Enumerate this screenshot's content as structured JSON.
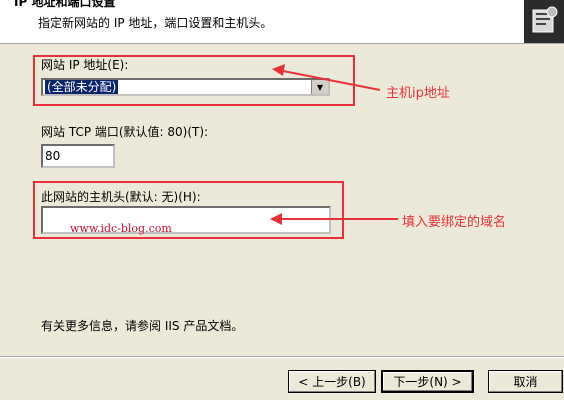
{
  "header": {
    "title": "IP 地址和端口设置",
    "subtitle": "指定新网站的 IP 地址，端口设置和主机头。"
  },
  "ip": {
    "label": "网站 IP 地址(E):",
    "selected": "(全部未分配)"
  },
  "port": {
    "label": "网站 TCP 端口(默认值: 80)(T):",
    "value": "80"
  },
  "host": {
    "label": "此网站的主机头(默认: 无)(H):",
    "value": "www.idc-blog.com"
  },
  "annotations": {
    "ip_note": "主机ip地址",
    "host_note": "填入要绑定的域名"
  },
  "info_text": "有关更多信息，请参阅 IIS 产品文档。",
  "buttons": {
    "back": "< 上一步(B)",
    "next": "下一步(N) >",
    "cancel": "取消"
  },
  "colors": {
    "annotation": "#e8323a",
    "selection": "#0a246a"
  }
}
